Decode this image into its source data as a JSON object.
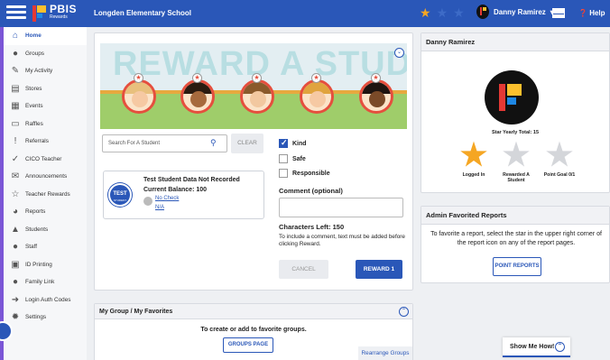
{
  "topbar": {
    "logo": "PBIS",
    "logo_sub": "Rewards",
    "school": "Longden Elementary School",
    "user": "Danny Ramirez",
    "user_caret": "▾",
    "help": "Help",
    "star_colors": [
      "#f5a623",
      "#3d6bc7",
      "#3d6bc7"
    ]
  },
  "sidebar": {
    "items": [
      {
        "label": "Home",
        "icon": "home-icon",
        "glyph": "⌂"
      },
      {
        "label": "Groups",
        "icon": "groups-icon",
        "glyph": "●"
      },
      {
        "label": "My Activity",
        "icon": "activity-icon",
        "glyph": "✎"
      },
      {
        "label": "Stores",
        "icon": "store-icon",
        "glyph": "▤"
      },
      {
        "label": "Events",
        "icon": "calendar-icon",
        "glyph": "▦"
      },
      {
        "label": "Raffles",
        "icon": "ticket-icon",
        "glyph": "▭"
      },
      {
        "label": "Referrals",
        "icon": "alert-icon",
        "glyph": "!"
      },
      {
        "label": "CICO Teacher",
        "icon": "check-circle-icon",
        "glyph": "✓"
      },
      {
        "label": "Announcements",
        "icon": "mail-icon",
        "glyph": "✉"
      },
      {
        "label": "Teacher Rewards",
        "icon": "star-icon",
        "glyph": "☆"
      },
      {
        "label": "Reports",
        "icon": "pie-chart-icon",
        "glyph": "◕"
      },
      {
        "label": "Students",
        "icon": "graduation-cap-icon",
        "glyph": "▲"
      },
      {
        "label": "Staff",
        "icon": "user-icon",
        "glyph": "●"
      },
      {
        "label": "ID Printing",
        "icon": "printer-icon",
        "glyph": "▣"
      },
      {
        "label": "Family Link",
        "icon": "family-icon",
        "glyph": "●"
      },
      {
        "label": "Login Auth Codes",
        "icon": "login-icon",
        "glyph": "➜"
      },
      {
        "label": "Settings",
        "icon": "gear-icon",
        "glyph": "✹"
      }
    ]
  },
  "reward": {
    "banner_title": "REWARD A STUDENT",
    "search_placeholder": "Search For A Student",
    "clear": "CLEAR",
    "student": {
      "badge": "TEST",
      "badge_sub": "STUDENT",
      "name": "Test Student Data Not Recorded",
      "balance": "Current Balance: 100",
      "link1": "No Check",
      "link2": "N/A"
    },
    "behaviors": [
      {
        "label": "Kind",
        "checked": true
      },
      {
        "label": "Safe",
        "checked": false
      },
      {
        "label": "Responsible",
        "checked": false
      }
    ],
    "comment_label": "Comment (optional)",
    "chars_left": "Characters Left: 150",
    "hint": "To include a comment, text must be added before clicking Reward.",
    "cancel": "CANCEL",
    "reward_btn": "REWARD 1"
  },
  "groups": {
    "title": "My Group / My Favorites",
    "message": "To create or add to favorite groups.",
    "button": "GROUPS PAGE",
    "rearrange": "Rearrange Groups"
  },
  "profile": {
    "name": "Danny Ramirez",
    "star_total": "Star Yearly Total: 15",
    "achievements": [
      {
        "label": "Logged In",
        "color": "#f5a623"
      },
      {
        "label": "Rewarded A Student",
        "color": "#d4d6da"
      },
      {
        "label": "Point Goal 0/1",
        "color": "#d4d6da"
      }
    ]
  },
  "admin": {
    "title": "Admin Favorited Reports",
    "message": "To favorite a report, select the star in the upper right corner of the report icon on any of the report pages.",
    "button": "POINT REPORTS"
  },
  "help_widget": {
    "label": "Show Me How!"
  }
}
